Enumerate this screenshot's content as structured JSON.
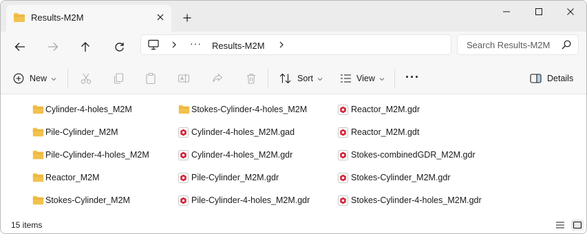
{
  "window": {
    "tab_title": "Results-M2M",
    "new_tab_symbol": "+",
    "controls": [
      "minimize",
      "maximize",
      "close"
    ]
  },
  "navigation": {
    "breadcrumb_overflow": "···",
    "current_folder": "Results-M2M",
    "search_placeholder": "Search Results-M2M"
  },
  "commandbar": {
    "new_label": "New",
    "sort_label": "Sort",
    "view_label": "View",
    "more_label": "···",
    "details_label": "Details"
  },
  "files": [
    {
      "name": "Cylinder-4-holes_M2M",
      "type": "folder"
    },
    {
      "name": "Pile-Cylinder_M2M",
      "type": "folder"
    },
    {
      "name": "Pile-Cylinder-4-holes_M2M",
      "type": "folder"
    },
    {
      "name": "Reactor_M2M",
      "type": "folder"
    },
    {
      "name": "Stokes-Cylinder_M2M",
      "type": "folder"
    },
    {
      "name": "Stokes-Cylinder-4-holes_M2M",
      "type": "folder"
    },
    {
      "name": "Cylinder-4-holes_M2M.gad",
      "type": "gad"
    },
    {
      "name": "Cylinder-4-holes_M2M.gdr",
      "type": "gdr"
    },
    {
      "name": "Pile-Cylinder_M2M.gdr",
      "type": "gdr"
    },
    {
      "name": "Pile-Cylinder-4-holes_M2M.gdr",
      "type": "gdr"
    },
    {
      "name": "Reactor_M2M.gdr",
      "type": "gdr"
    },
    {
      "name": "Reactor_M2M.gdt",
      "type": "gdt"
    },
    {
      "name": "Stokes-combinedGDR_M2M.gdr",
      "type": "gdr"
    },
    {
      "name": "Stokes-Cylinder_M2M.gdr",
      "type": "gdr"
    },
    {
      "name": "Stokes-Cylinder-4-holes_M2M.gdr",
      "type": "gdr"
    }
  ],
  "status": {
    "item_count": "15 items"
  },
  "colors": {
    "folder": "#f2c14e",
    "folder_dark": "#e0a82e",
    "app_icon_red": "#d6263a",
    "accent": "#0067c0"
  }
}
